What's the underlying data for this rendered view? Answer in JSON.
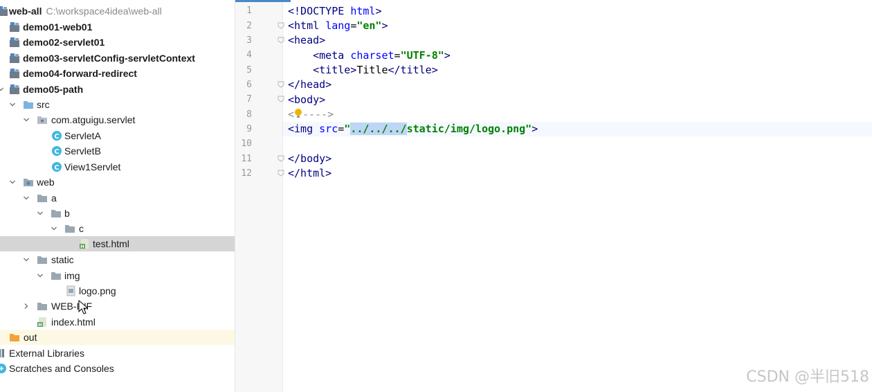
{
  "project_tree": {
    "root": {
      "label": "web-all",
      "path": "C:\\workspace4idea\\web-all"
    },
    "modules": [
      "demo01-web01",
      "demo02-servlet01",
      "demo03-servletConfig-servletContext",
      "demo04-forward-redirect",
      "demo05-path"
    ],
    "src": "src",
    "package": "com.atguigu.servlet",
    "classes": [
      "ServletA",
      "ServletB",
      "View1Servlet"
    ],
    "web": "web",
    "dir_a": "a",
    "dir_b": "b",
    "dir_c": "c",
    "test_file": "test.html",
    "static": "static",
    "img": "img",
    "logo": "logo.png",
    "web_inf": "WEB-INF",
    "index": "index.html",
    "out": "out",
    "external_libraries": "External Libraries",
    "scratches": "Scratches and Consoles"
  },
  "editor": {
    "line_numbers": [
      "1",
      "2",
      "3",
      "4",
      "5",
      "6",
      "7",
      "8",
      "9",
      "10",
      "11",
      "12"
    ],
    "line1": {
      "open": "<!DOCTYPE ",
      "name": "html",
      "close": ">"
    },
    "line2": {
      "open": "<html ",
      "attr": "lang",
      "eq": "=",
      "val": "\"en\"",
      "close": ">"
    },
    "line3": {
      "tag": "<head>"
    },
    "line4": {
      "open": "<meta ",
      "attr": "charset",
      "eq": "=",
      "val": "\"UTF-8\"",
      "close": ">"
    },
    "line5": {
      "open": "<title>",
      "text": "Title",
      "close": "</title>"
    },
    "line6": {
      "tag": "</head>"
    },
    "line7": {
      "tag": "<body>"
    },
    "line8": {
      "pre": "<",
      "post": "---->"
    },
    "line9": {
      "open": "<img ",
      "attr": "src",
      "eq": "=",
      "q1": "\"",
      "selected": "../../../",
      "rest": "static/img/logo.png\"",
      "close": ">"
    },
    "line11": {
      "tag": "</body>"
    },
    "line12": {
      "tag": "</html>"
    }
  },
  "watermark": "CSDN @半旧518",
  "colors": {
    "accent": "#4a88c7",
    "selection_row": "#d5d5d5",
    "text_selection": "#bed6f5",
    "string_green": "#008000",
    "tag_navy": "#000080",
    "attr_blue": "#0000ff"
  }
}
